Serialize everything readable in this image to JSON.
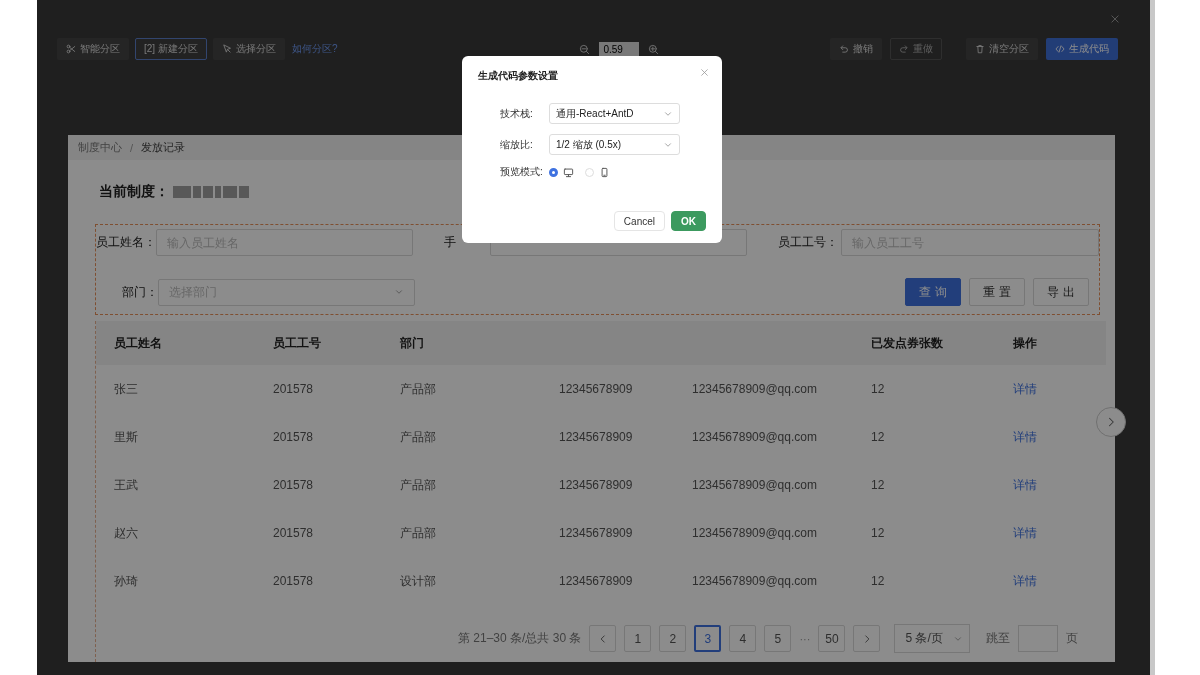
{
  "toolbar": {
    "left_tools": [
      {
        "label": "智能分区",
        "selected": false
      },
      {
        "label": "[2] 新建分区",
        "selected": true
      },
      {
        "label": "选择分区",
        "selected": false
      }
    ],
    "help_link": "如何分区?",
    "zoom": {
      "value": "0.59"
    },
    "right_tools": [
      {
        "label": "撤销",
        "kind": "default",
        "disabled": false
      },
      {
        "label": "重做",
        "kind": "default",
        "disabled": true
      },
      {
        "label": "清空分区",
        "kind": "default",
        "disabled": false
      },
      {
        "label": "生成代码",
        "kind": "primary",
        "disabled": false
      }
    ]
  },
  "page": {
    "breadcrumb": [
      "制度中心",
      "发放记录"
    ],
    "breadcrumb_separator": "/",
    "current_label": "当前制度：",
    "filters": {
      "name": {
        "label": "员工姓名：",
        "placeholder": "输入员工姓名"
      },
      "phone": {
        "label": "手"
      },
      "id": {
        "label": "员工工号：",
        "placeholder": "输入员工工号"
      },
      "dept": {
        "label": "部门：",
        "placeholder": "选择部门"
      }
    },
    "buttons": [
      {
        "label": "查 询",
        "kind": "primary"
      },
      {
        "label": "重 置",
        "kind": "default"
      },
      {
        "label": "导 出",
        "kind": "default"
      }
    ],
    "table": {
      "columns": [
        {
          "label": "员工姓名"
        },
        {
          "label": "员工工号"
        },
        {
          "label": "部门"
        },
        {},
        {},
        {
          "label": "已发点券张数"
        },
        {
          "label": "操作"
        }
      ],
      "rows": [
        [
          "张三",
          "201578",
          "产品部",
          "12345678909",
          "12345678909@qq.com",
          "12",
          "详情"
        ],
        [
          "里斯",
          "201578",
          "产品部",
          "12345678909",
          "12345678909@qq.com",
          "12",
          "详情"
        ],
        [
          "王武",
          "201578",
          "产品部",
          "12345678909",
          "12345678909@qq.com",
          "12",
          "详情"
        ],
        [
          "赵六",
          "201578",
          "产品部",
          "12345678909",
          "12345678909@qq.com",
          "12",
          "详情"
        ],
        [
          "孙琦",
          "201578",
          "设计部",
          "12345678909",
          "12345678909@qq.com",
          "12",
          "详情"
        ]
      ]
    },
    "pagination": {
      "summary": "第 21–30 条/总共 30 条",
      "pages": [
        {
          "label": "1",
          "selected": false
        },
        {
          "label": "2",
          "selected": false
        },
        {
          "label": "3",
          "selected": true
        },
        {
          "label": "4",
          "selected": false
        },
        {
          "label": "5",
          "selected": false
        },
        {
          "label": "···",
          "kind": "ellipsis"
        },
        {
          "label": "50",
          "selected": false
        }
      ],
      "page_size": "5 条/页",
      "jump_label": "跳至",
      "page_unit": "页"
    }
  },
  "dialog": {
    "title": "生成代码参数设置",
    "fields": [
      {
        "label": "技术栈:",
        "value": "通用-React+AntD"
      },
      {
        "label": "缩放比:",
        "value": "1/2 缩放 (0.5x)"
      }
    ],
    "preview": {
      "label": "预览模式:",
      "options": [
        {
          "selected": true
        },
        {
          "selected": false
        }
      ]
    },
    "buttons": [
      {
        "label": "Cancel",
        "kind": "default"
      },
      {
        "label": "OK",
        "kind": "primary"
      }
    ]
  }
}
